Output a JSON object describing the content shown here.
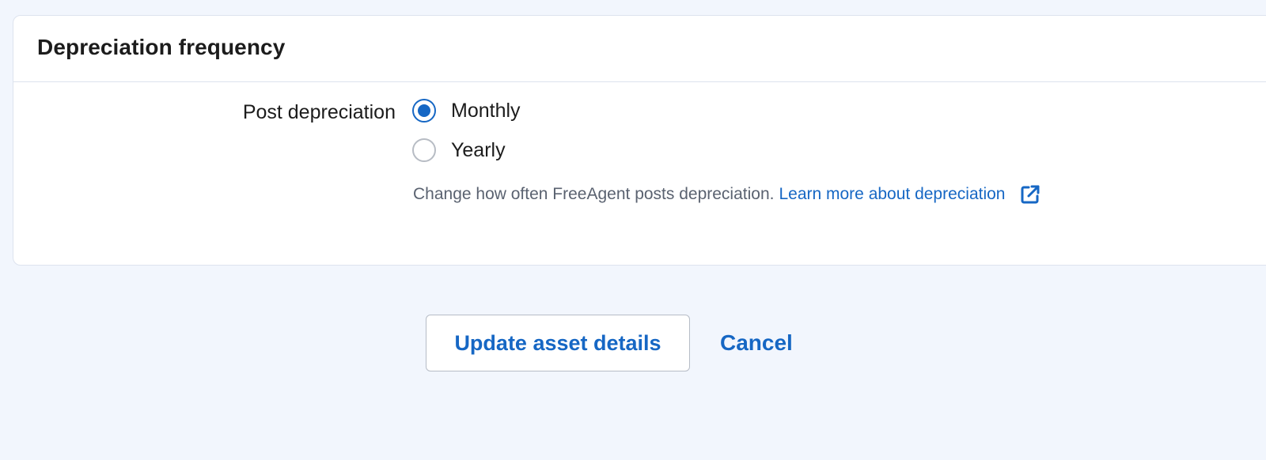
{
  "section": {
    "title": "Depreciation frequency"
  },
  "field": {
    "label": "Post depreciation",
    "options": [
      {
        "label": "Monthly",
        "checked": true
      },
      {
        "label": "Yearly",
        "checked": false
      }
    ],
    "help_text": "Change how often FreeAgent posts depreciation.",
    "help_link": "Learn more about depreciation",
    "help_link_icon": "external-link-icon"
  },
  "actions": {
    "update_label": "Update asset details",
    "cancel_label": "Cancel"
  },
  "colors": {
    "accent": "#1667c4",
    "page_background": "#f2f6fd",
    "help_text": "#5a6270"
  }
}
